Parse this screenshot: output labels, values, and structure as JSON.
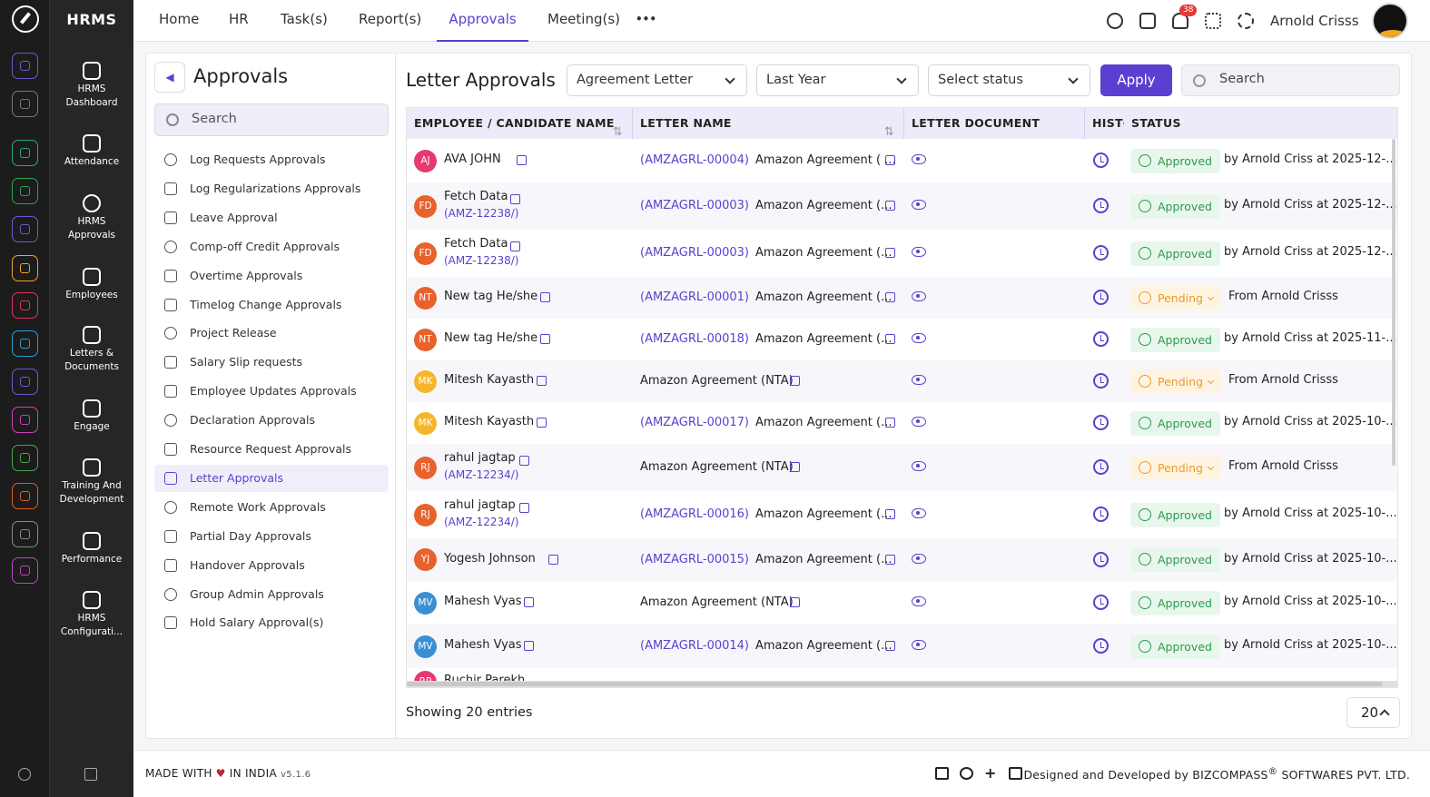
{
  "rail_icons": [
    "home-icon",
    "pin-icon",
    "people-icon",
    "target-icon",
    "briefcase-icon",
    "handshake-icon",
    "goal-icon",
    "calendar-icon",
    "chart-icon",
    "monitor-icon",
    "document-icon",
    "award-icon",
    "building-icon",
    "settings-icon"
  ],
  "sidebar": {
    "brand": "HRMS",
    "items": [
      {
        "line1": "HRMS",
        "line2": "Dashboard"
      },
      {
        "line1": "Attendance",
        "line2": ""
      },
      {
        "line1": "HRMS",
        "line2": "Approvals"
      },
      {
        "line1": "Employees",
        "line2": ""
      },
      {
        "line1": "Letters &",
        "line2": "Documents"
      },
      {
        "line1": "Engage",
        "line2": ""
      },
      {
        "line1": "Training And",
        "line2": "Development"
      },
      {
        "line1": "Performance",
        "line2": ""
      },
      {
        "line1": "HRMS",
        "line2": "Configurati..."
      }
    ]
  },
  "topnav": {
    "items": [
      "Home",
      "HR",
      "Task(s)",
      "Report(s)",
      "Approvals",
      "Meeting(s)"
    ],
    "more": "•••",
    "active": "Approvals",
    "notification_count": "38",
    "user_name": "Arnold Crisss"
  },
  "left_panel": {
    "title": "Approvals",
    "search_placeholder": "Search",
    "items": [
      "Log Requests Approvals",
      "Log Regularizations Approvals",
      "Leave Approval",
      "Comp-off Credit Approvals",
      "Overtime Approvals",
      "Timelog Change Approvals",
      "Project Release",
      "Salary Slip requests",
      "Employee Updates Approvals",
      "Declaration Approvals",
      "Resource Request Approvals",
      "Letter Approvals",
      "Remote Work Approvals",
      "Partial Day Approvals",
      "Handover Approvals",
      "Group Admin Approvals",
      "Hold Salary Approval(s)"
    ],
    "active": "Letter Approvals"
  },
  "main": {
    "title": "Letter Approvals",
    "filter_letter": "Agreement Letter",
    "filter_period": "Last Year",
    "filter_status": "Select status",
    "apply_label": "Apply",
    "search_placeholder": "Search",
    "columns": [
      "EMPLOYEE / CANDIDATE NAME",
      "LETTER NAME",
      "LETTER DOCUMENT",
      "HISTORY",
      "STATUS"
    ],
    "sort_glyph": "⇅",
    "rows": [
      {
        "initials": "AJ",
        "color": "#e53970",
        "name": "AVA JOHN",
        "code": "",
        "letter_code": "(AMZAGRL-00004)",
        "letter_name": "Amazon Agreement ( ...",
        "status": "Approved",
        "by": "by Arnold Criss at 2025-12-..."
      },
      {
        "initials": "FD",
        "color": "#e8622c",
        "name": "Fetch Data",
        "code": "(AMZ-12238/)",
        "letter_code": "(AMZAGRL-00003)",
        "letter_name": "Amazon Agreement (...",
        "status": "Approved",
        "by": "by Arnold Criss at 2025-12-..."
      },
      {
        "initials": "FD",
        "color": "#e8622c",
        "name": "Fetch Data",
        "code": "(AMZ-12238/)",
        "letter_code": "(AMZAGRL-00003)",
        "letter_name": "Amazon Agreement (...",
        "status": "Approved",
        "by": "by Arnold Criss at 2025-12-..."
      },
      {
        "initials": "NT",
        "color": "#e8622c",
        "name": "New tag He/she",
        "code": "",
        "letter_code": "(AMZAGRL-00001)",
        "letter_name": "Amazon Agreement (...",
        "status": "Pending",
        "by": "From Arnold Crisss"
      },
      {
        "initials": "NT",
        "color": "#e8622c",
        "name": "New tag He/she",
        "code": "",
        "letter_code": "(AMZAGRL-00018)",
        "letter_name": "Amazon Agreement (...",
        "status": "Approved",
        "by": "by Arnold Criss at 2025-11-..."
      },
      {
        "initials": "MK",
        "color": "#f5b62a",
        "name": "Mitesh Kayasth",
        "code": "",
        "letter_code": "",
        "letter_name": "Amazon Agreement (NTA)",
        "status": "Pending",
        "by": "From Arnold Crisss"
      },
      {
        "initials": "MK",
        "color": "#f5b62a",
        "name": "Mitesh Kayasth",
        "code": "",
        "letter_code": "(AMZAGRL-00017)",
        "letter_name": "Amazon Agreement (...",
        "status": "Approved",
        "by": "by Arnold Criss at 2025-10-..."
      },
      {
        "initials": "RJ",
        "color": "#e8622c",
        "name": "rahul jagtap",
        "code": "(AMZ-12234/)",
        "letter_code": "",
        "letter_name": "Amazon Agreement (NTA)",
        "status": "Pending",
        "by": "From Arnold Crisss"
      },
      {
        "initials": "RJ",
        "color": "#e8622c",
        "name": "rahul jagtap",
        "code": "(AMZ-12234/)",
        "letter_code": "(AMZAGRL-00016)",
        "letter_name": "Amazon Agreement (...",
        "status": "Approved",
        "by": "by Arnold Criss at 2025-10-..."
      },
      {
        "initials": "YJ",
        "color": "#e8622c",
        "name": "Yogesh Johnson",
        "code": "",
        "letter_code": "(AMZAGRL-00015)",
        "letter_name": "Amazon Agreement (...",
        "status": "Approved",
        "by": "by Arnold Criss at 2025-10-..."
      },
      {
        "initials": "MV",
        "color": "#3a8fd1",
        "name": "Mahesh Vyas",
        "code": "",
        "letter_code": "",
        "letter_name": "Amazon Agreement (NTA)",
        "status": "Approved",
        "by": "by Arnold Criss at 2025-10-..."
      },
      {
        "initials": "MV",
        "color": "#3a8fd1",
        "name": "Mahesh Vyas",
        "code": "",
        "letter_code": "(AMZAGRL-00014)",
        "letter_name": "Amazon Agreement (...",
        "status": "Approved",
        "by": "by Arnold Criss at 2025-10-..."
      },
      {
        "initials": "RP",
        "color": "#e53970",
        "name": "Ruchir Parekh",
        "code": "",
        "letter_code": "",
        "letter_name": "",
        "status": "",
        "by": ""
      }
    ],
    "showing": "Showing 20 entries",
    "page_size": "20"
  },
  "footer": {
    "made": "MADE WITH",
    "heart": "♥",
    "made_tail": "IN INDIA",
    "version": "v5.1.6",
    "designed_by": "Designed and Developed by",
    "company": "BIZCOMPASS",
    "reg": "®",
    "company_tail": "SOFTWARES PVT. LTD."
  }
}
